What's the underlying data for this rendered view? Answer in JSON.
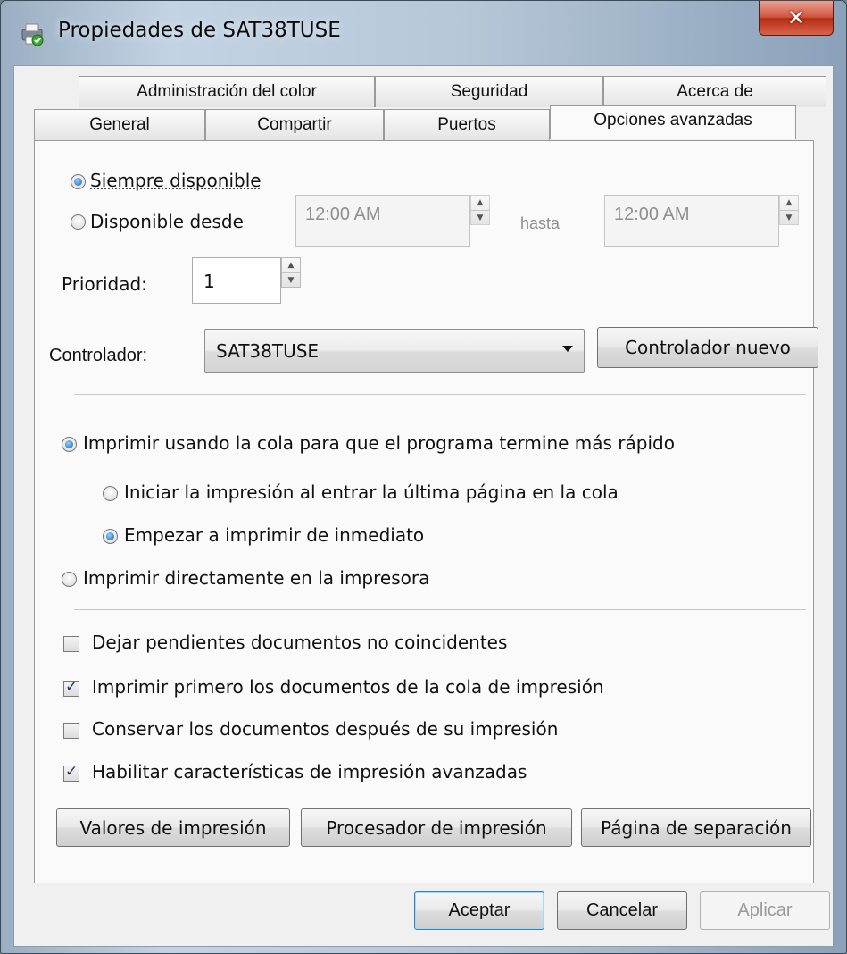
{
  "window": {
    "title": "Propiedades de SAT38TUSE",
    "close_glyph": "✕"
  },
  "tabs_back": [
    "Administración del color",
    "Seguridad",
    "Acerca de"
  ],
  "tabs_front": [
    "General",
    "Compartir",
    "Puertos",
    "Opciones avanzadas"
  ],
  "availability": {
    "always_label": "Siempre disponible",
    "always_selected": true,
    "from_label": "Disponible desde",
    "from_time": "12:00 AM",
    "until_label": "hasta",
    "until_time": "12:00 AM"
  },
  "priority": {
    "label": "Prioridad:",
    "value": "1"
  },
  "driver": {
    "label": "Controlador:",
    "selected": "SAT38TUSE",
    "new_button": "Controlador nuevo"
  },
  "spooling": {
    "spool_label": "Imprimir usando la cola para que el programa termine más rápido",
    "start_after_last_label": "Iniciar la impresión al entrar la última página en la cola",
    "start_immediately_label": "Empezar a imprimir de inmediato",
    "direct_label": "Imprimir directamente en la impresora"
  },
  "options": [
    {
      "label": "Dejar pendientes documentos no coincidentes",
      "checked": false
    },
    {
      "label": "Imprimir primero los documentos de la cola de impresión",
      "checked": true
    },
    {
      "label": "Conservar los documentos después de su impresión",
      "checked": false
    },
    {
      "label": "Habilitar características de impresión avanzadas",
      "checked": true
    }
  ],
  "bottom_buttons": {
    "defaults": "Valores de impresión",
    "processor": "Procesador de impresión",
    "separator": "Página de separación"
  },
  "dialog_buttons": {
    "ok": "Aceptar",
    "cancel": "Cancelar",
    "apply": "Aplicar"
  }
}
